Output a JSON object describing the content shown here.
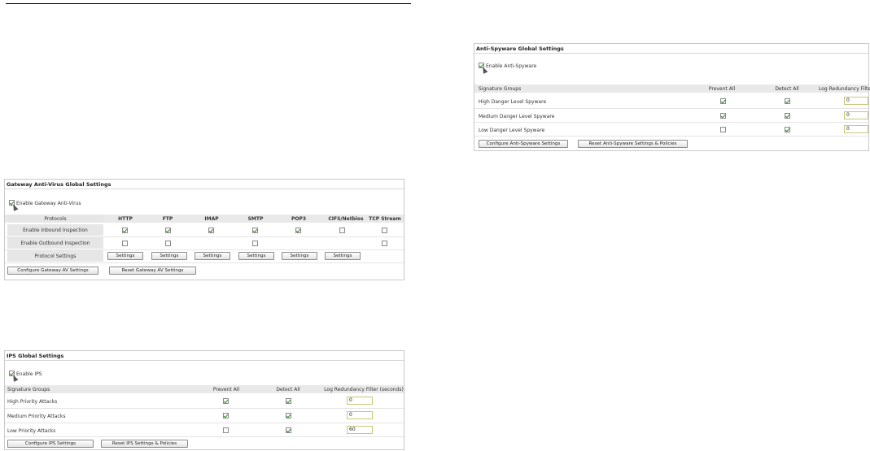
{
  "gav": {
    "title": "Gateway Anti-Virus Global Settings",
    "enable_label": "Enable Gateway Anti-Virus",
    "enable_checked": true,
    "protocols_header": "Protocols",
    "columns": [
      "HTTP",
      "FTP",
      "IMAP",
      "SMTP",
      "POP3",
      "CIFS/Netbios",
      "TCP Stream"
    ],
    "rows": [
      {
        "label": "Enable Inbound Inspection",
        "checks": [
          true,
          true,
          true,
          true,
          true,
          false,
          false
        ]
      },
      {
        "label": "Enable Outbound Inspection",
        "checks": [
          false,
          false,
          null,
          false,
          null,
          null,
          false
        ]
      }
    ],
    "protocol_settings_label": "Protocol Settings",
    "settings_button": "Settings",
    "configure_button": "Configure Gateway AV Settings",
    "reset_button": "Reset Gateway AV Settings"
  },
  "ips": {
    "title": "IPS Global Settings",
    "enable_label": "Enable IPS",
    "enable_checked": true,
    "headers": [
      "Signature Groups",
      "Prevent All",
      "Detect All",
      "Log Redundancy Filter (seconds)"
    ],
    "rows": [
      {
        "label": "High Priority Attacks",
        "prevent": true,
        "detect": true,
        "filter": "0"
      },
      {
        "label": "Medium Priority Attacks",
        "prevent": true,
        "detect": true,
        "filter": "0"
      },
      {
        "label": "Low Priority Attacks",
        "prevent": false,
        "detect": true,
        "filter": "60"
      }
    ],
    "configure_button": "Configure IPS Settings",
    "reset_button": "Reset IPS Settings & Policies"
  },
  "asw": {
    "title": "Anti-Spyware Global Settings",
    "enable_label": "Enable Anti-Spyware",
    "enable_checked": true,
    "headers": [
      "Signature Groups",
      "Prevent All",
      "Detect All",
      "Log Redundancy Filter"
    ],
    "rows": [
      {
        "label": "High Danger Level Spyware",
        "prevent": true,
        "detect": true,
        "filter": "0"
      },
      {
        "label": "Medium Danger Level Spyware",
        "prevent": true,
        "detect": true,
        "filter": "0"
      },
      {
        "label": "Low Danger Level Spyware",
        "prevent": false,
        "detect": true,
        "filter": "0"
      }
    ],
    "configure_button": "Configure Anti-Spyware Settings",
    "reset_button": "Reset Anti-Spyware Settings & Policies"
  }
}
